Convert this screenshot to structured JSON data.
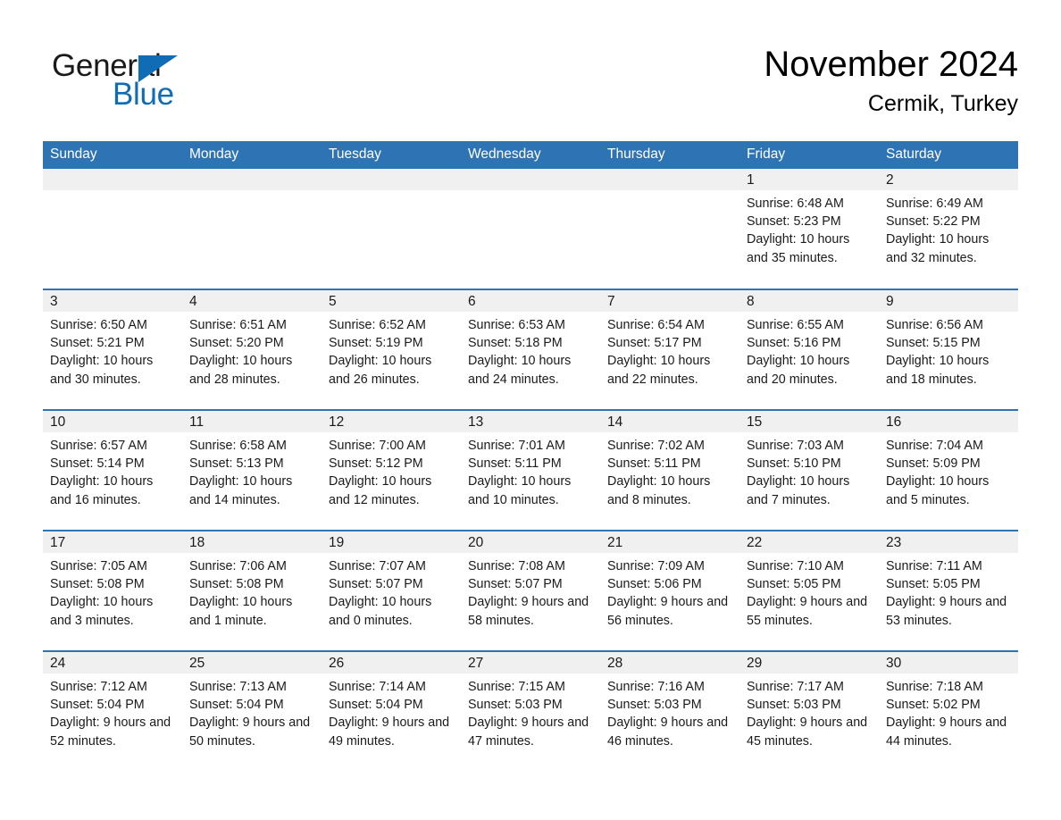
{
  "brand": {
    "name_part1": "General",
    "name_part2": "Blue",
    "accent_color": "#0f6cb5"
  },
  "header": {
    "month_year": "November 2024",
    "location": "Cermik, Turkey",
    "header_bg_color": "#2e74b5"
  },
  "calendar": {
    "weekday_headers": [
      "Sunday",
      "Monday",
      "Tuesday",
      "Wednesday",
      "Thursday",
      "Friday",
      "Saturday"
    ],
    "weeks": [
      [
        {
          "day": "",
          "empty": true
        },
        {
          "day": "",
          "empty": true
        },
        {
          "day": "",
          "empty": true
        },
        {
          "day": "",
          "empty": true
        },
        {
          "day": "",
          "empty": true
        },
        {
          "day": "1",
          "sunrise": "Sunrise: 6:48 AM",
          "sunset": "Sunset: 5:23 PM",
          "daylight": "Daylight: 10 hours and 35 minutes."
        },
        {
          "day": "2",
          "sunrise": "Sunrise: 6:49 AM",
          "sunset": "Sunset: 5:22 PM",
          "daylight": "Daylight: 10 hours and 32 minutes."
        }
      ],
      [
        {
          "day": "3",
          "sunrise": "Sunrise: 6:50 AM",
          "sunset": "Sunset: 5:21 PM",
          "daylight": "Daylight: 10 hours and 30 minutes."
        },
        {
          "day": "4",
          "sunrise": "Sunrise: 6:51 AM",
          "sunset": "Sunset: 5:20 PM",
          "daylight": "Daylight: 10 hours and 28 minutes."
        },
        {
          "day": "5",
          "sunrise": "Sunrise: 6:52 AM",
          "sunset": "Sunset: 5:19 PM",
          "daylight": "Daylight: 10 hours and 26 minutes."
        },
        {
          "day": "6",
          "sunrise": "Sunrise: 6:53 AM",
          "sunset": "Sunset: 5:18 PM",
          "daylight": "Daylight: 10 hours and 24 minutes."
        },
        {
          "day": "7",
          "sunrise": "Sunrise: 6:54 AM",
          "sunset": "Sunset: 5:17 PM",
          "daylight": "Daylight: 10 hours and 22 minutes."
        },
        {
          "day": "8",
          "sunrise": "Sunrise: 6:55 AM",
          "sunset": "Sunset: 5:16 PM",
          "daylight": "Daylight: 10 hours and 20 minutes."
        },
        {
          "day": "9",
          "sunrise": "Sunrise: 6:56 AM",
          "sunset": "Sunset: 5:15 PM",
          "daylight": "Daylight: 10 hours and 18 minutes."
        }
      ],
      [
        {
          "day": "10",
          "sunrise": "Sunrise: 6:57 AM",
          "sunset": "Sunset: 5:14 PM",
          "daylight": "Daylight: 10 hours and 16 minutes."
        },
        {
          "day": "11",
          "sunrise": "Sunrise: 6:58 AM",
          "sunset": "Sunset: 5:13 PM",
          "daylight": "Daylight: 10 hours and 14 minutes."
        },
        {
          "day": "12",
          "sunrise": "Sunrise: 7:00 AM",
          "sunset": "Sunset: 5:12 PM",
          "daylight": "Daylight: 10 hours and 12 minutes."
        },
        {
          "day": "13",
          "sunrise": "Sunrise: 7:01 AM",
          "sunset": "Sunset: 5:11 PM",
          "daylight": "Daylight: 10 hours and 10 minutes."
        },
        {
          "day": "14",
          "sunrise": "Sunrise: 7:02 AM",
          "sunset": "Sunset: 5:11 PM",
          "daylight": "Daylight: 10 hours and 8 minutes."
        },
        {
          "day": "15",
          "sunrise": "Sunrise: 7:03 AM",
          "sunset": "Sunset: 5:10 PM",
          "daylight": "Daylight: 10 hours and 7 minutes."
        },
        {
          "day": "16",
          "sunrise": "Sunrise: 7:04 AM",
          "sunset": "Sunset: 5:09 PM",
          "daylight": "Daylight: 10 hours and 5 minutes."
        }
      ],
      [
        {
          "day": "17",
          "sunrise": "Sunrise: 7:05 AM",
          "sunset": "Sunset: 5:08 PM",
          "daylight": "Daylight: 10 hours and 3 minutes."
        },
        {
          "day": "18",
          "sunrise": "Sunrise: 7:06 AM",
          "sunset": "Sunset: 5:08 PM",
          "daylight": "Daylight: 10 hours and 1 minute."
        },
        {
          "day": "19",
          "sunrise": "Sunrise: 7:07 AM",
          "sunset": "Sunset: 5:07 PM",
          "daylight": "Daylight: 10 hours and 0 minutes."
        },
        {
          "day": "20",
          "sunrise": "Sunrise: 7:08 AM",
          "sunset": "Sunset: 5:07 PM",
          "daylight": "Daylight: 9 hours and 58 minutes."
        },
        {
          "day": "21",
          "sunrise": "Sunrise: 7:09 AM",
          "sunset": "Sunset: 5:06 PM",
          "daylight": "Daylight: 9 hours and 56 minutes."
        },
        {
          "day": "22",
          "sunrise": "Sunrise: 7:10 AM",
          "sunset": "Sunset: 5:05 PM",
          "daylight": "Daylight: 9 hours and 55 minutes."
        },
        {
          "day": "23",
          "sunrise": "Sunrise: 7:11 AM",
          "sunset": "Sunset: 5:05 PM",
          "daylight": "Daylight: 9 hours and 53 minutes."
        }
      ],
      [
        {
          "day": "24",
          "sunrise": "Sunrise: 7:12 AM",
          "sunset": "Sunset: 5:04 PM",
          "daylight": "Daylight: 9 hours and 52 minutes."
        },
        {
          "day": "25",
          "sunrise": "Sunrise: 7:13 AM",
          "sunset": "Sunset: 5:04 PM",
          "daylight": "Daylight: 9 hours and 50 minutes."
        },
        {
          "day": "26",
          "sunrise": "Sunrise: 7:14 AM",
          "sunset": "Sunset: 5:04 PM",
          "daylight": "Daylight: 9 hours and 49 minutes."
        },
        {
          "day": "27",
          "sunrise": "Sunrise: 7:15 AM",
          "sunset": "Sunset: 5:03 PM",
          "daylight": "Daylight: 9 hours and 47 minutes."
        },
        {
          "day": "28",
          "sunrise": "Sunrise: 7:16 AM",
          "sunset": "Sunset: 5:03 PM",
          "daylight": "Daylight: 9 hours and 46 minutes."
        },
        {
          "day": "29",
          "sunrise": "Sunrise: 7:17 AM",
          "sunset": "Sunset: 5:03 PM",
          "daylight": "Daylight: 9 hours and 45 minutes."
        },
        {
          "day": "30",
          "sunrise": "Sunrise: 7:18 AM",
          "sunset": "Sunset: 5:02 PM",
          "daylight": "Daylight: 9 hours and 44 minutes."
        }
      ]
    ]
  }
}
